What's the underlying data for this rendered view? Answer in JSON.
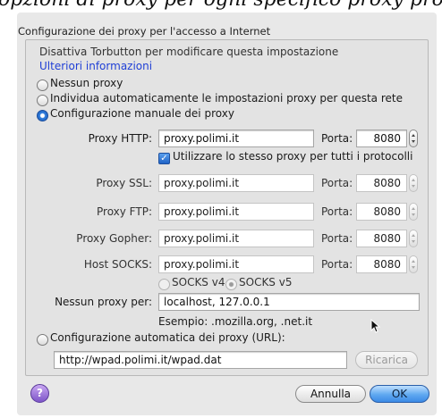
{
  "top_strip": "opzioni di proxy per ogni specifico proxy proxy",
  "dialog": {
    "section_title": "Configurazione dei proxy per l'accesso a Internet",
    "notice": "Disattiva Torbutton per modificare questa impostazione",
    "more_info_link": "Ulteriori informazioni",
    "radios": {
      "no_proxy": "Nessun proxy",
      "auto_detect": "Individua automaticamente le impostazioni proxy per questa rete",
      "manual": "Configurazione manuale dei proxy",
      "auto_url": "Configurazione automatica dei proxy (URL):"
    },
    "http": {
      "label": "Proxy HTTP:",
      "host": "proxy.polimi.it",
      "port_label": "Porta:",
      "port": "8080"
    },
    "same_proxy_label": "Utilizzare lo stesso proxy per tutti i protocolli",
    "ssl": {
      "label": "Proxy SSL:",
      "host": "proxy.polimi.it",
      "port_label": "Porta:",
      "port": "8080"
    },
    "ftp": {
      "label": "Proxy FTP:",
      "host": "proxy.polimi.it",
      "port_label": "Porta:",
      "port": "8080"
    },
    "gopher": {
      "label": "Proxy Gopher:",
      "host": "proxy.polimi.it",
      "port_label": "Porta:",
      "port": "8080"
    },
    "socks": {
      "label": "Host SOCKS:",
      "host": "proxy.polimi.it",
      "port_label": "Porta:",
      "port": "8080"
    },
    "socks_v4": "SOCKS v4",
    "socks_v5": "SOCKS v5",
    "no_proxy_for": {
      "label": "Nessun proxy per:",
      "value": "localhost, 127.0.0.1"
    },
    "example": "Esempio: .mozilla.org, .net.it",
    "auto_url_value": "http://wpad.polimi.it/wpad.dat",
    "reload_button": "Ricarica",
    "cancel_button": "Annulla",
    "ok_button": "OK",
    "help_glyph": "?"
  }
}
